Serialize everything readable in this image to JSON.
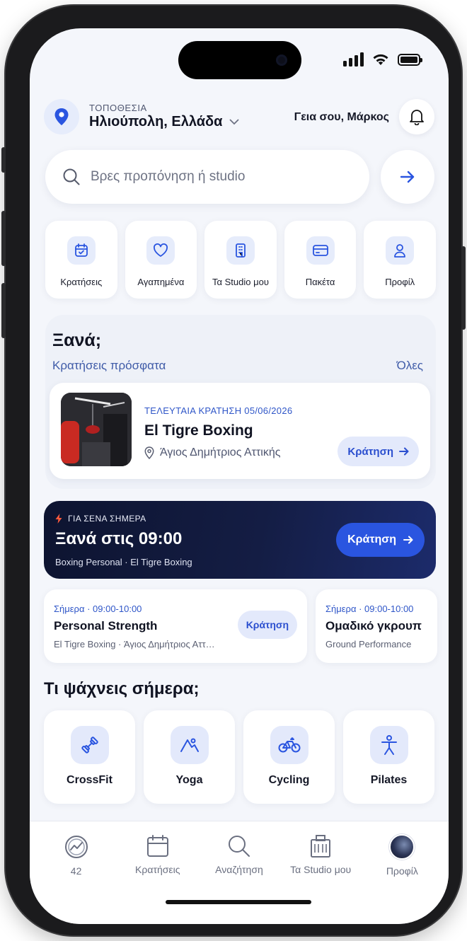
{
  "location": {
    "caption": "ΤΟΠΟΘΕΣΙΑ",
    "name": "Ηλιούπολη, Ελλάδα"
  },
  "greeting": "Γεια σου, Μάρκος",
  "search": {
    "placeholder": "Βρες προπόνηση ή studio"
  },
  "quick_actions": [
    {
      "label": "Κρατήσεις",
      "icon": "calendar-check-icon"
    },
    {
      "label": "Αγαπημένα",
      "icon": "heart-icon"
    },
    {
      "label": "Τα Studio μου",
      "icon": "building-icon"
    },
    {
      "label": "Πακέτα",
      "icon": "credit-card-icon"
    },
    {
      "label": "Προφίλ",
      "icon": "user-icon"
    }
  ],
  "again": {
    "title": "Ξανά;",
    "subtitle": "Κρατήσεις πρόσφατα",
    "see_all": "Όλες",
    "card": {
      "meta": "ΤΕΛΕΥΤΑΙΑ ΚΡΑΤΗΣΗ 05/06/2026",
      "name": "El Tigre Boxing",
      "location": "Άγιος Δημήτριος Αττικής",
      "button": "Κράτηση"
    }
  },
  "promo": {
    "kicker": "ΓΙΑ ΣΕΝΑ ΣΗΜΕΡΑ",
    "title": "Ξανά στις 09:00",
    "subtitle": "Boxing Personal · El Tigre Boxing",
    "button": "Κράτηση"
  },
  "schedule": [
    {
      "time": "Σήμερα · 09:00-10:00",
      "title": "Personal Strength",
      "place": "El Tigre Boxing · Άγιος Δημήτριος Αττ…",
      "button": "Κράτηση"
    },
    {
      "time": "Σήμερα · 09:00-10:00",
      "title": "Ομαδικό γκρουπ",
      "place": "Ground Performance"
    }
  ],
  "categories_title": "Τι ψάχνεις σήμερα;",
  "categories": [
    {
      "label": "CrossFit",
      "icon": "dumbbell-icon"
    },
    {
      "label": "Yoga",
      "icon": "yoga-icon"
    },
    {
      "label": "Cycling",
      "icon": "bicycle-icon"
    },
    {
      "label": "Pilates",
      "icon": "pilates-icon"
    }
  ],
  "tabs": [
    {
      "label": "42",
      "icon": "activity-ring-icon"
    },
    {
      "label": "Κρατήσεις",
      "icon": "calendar-icon"
    },
    {
      "label": "Αναζήτηση",
      "icon": "search-icon"
    },
    {
      "label": "Τα Studio μου",
      "icon": "building-icon"
    },
    {
      "label": "Προφίλ",
      "icon": "avatar"
    }
  ],
  "colors": {
    "accent": "#2a55e0",
    "accent_soft": "#e3e9fb",
    "promo_bg": "#0d1430",
    "background": "#f4f6fb"
  }
}
